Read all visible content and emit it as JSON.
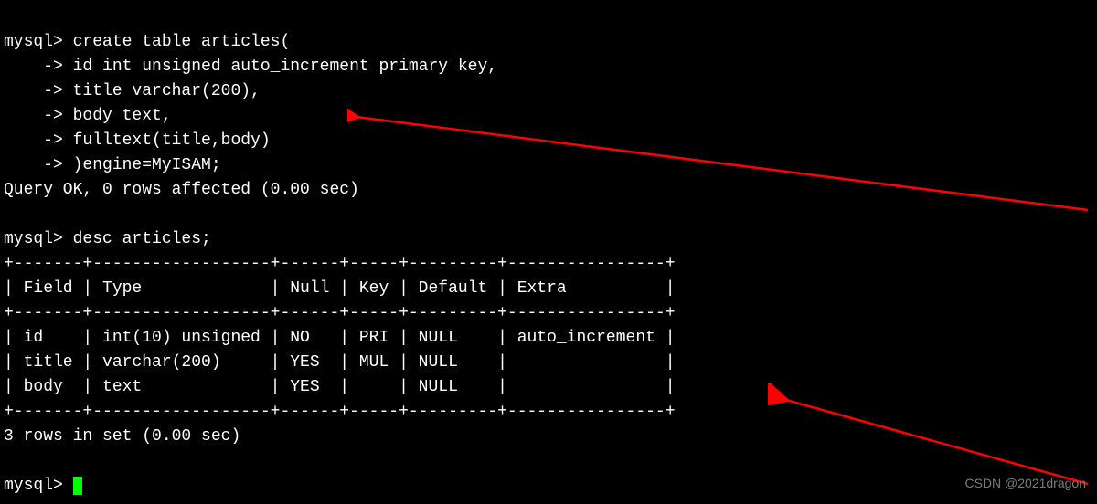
{
  "prompt": "mysql>",
  "continuation": "    ->",
  "create_table": {
    "line1": " create table articles(",
    "line2": " id int unsigned auto_increment primary key,",
    "line3": " title varchar(200),",
    "line4": " body text,",
    "line5": " fulltext(title,body)",
    "line6": " )engine=MyISAM;"
  },
  "query_ok": "Query OK, 0 rows affected (0.00 sec)",
  "blank": "",
  "desc_cmd": " desc articles;",
  "table_border": "+-------+------------------+------+-----+---------+----------------+",
  "table_header": "| Field | Type             | Null | Key | Default | Extra          |",
  "table_rows": {
    "r1": "| id    | int(10) unsigned | NO   | PRI | NULL    | auto_increment |",
    "r2": "| title | varchar(200)     | YES  | MUL | NULL    |                |",
    "r3": "| body  | text             | YES  |     | NULL    |                |"
  },
  "rows_in_set": "3 rows in set (0.00 sec)",
  "cursor_prompt": "mysql> ",
  "watermark": "CSDN @2021dragon",
  "chart_data": {
    "type": "table",
    "title": "desc articles",
    "columns": [
      "Field",
      "Type",
      "Null",
      "Key",
      "Default",
      "Extra"
    ],
    "rows": [
      [
        "id",
        "int(10) unsigned",
        "NO",
        "PRI",
        "NULL",
        "auto_increment"
      ],
      [
        "title",
        "varchar(200)",
        "YES",
        "MUL",
        "NULL",
        ""
      ],
      [
        "body",
        "text",
        "YES",
        "",
        "NULL",
        ""
      ]
    ]
  }
}
